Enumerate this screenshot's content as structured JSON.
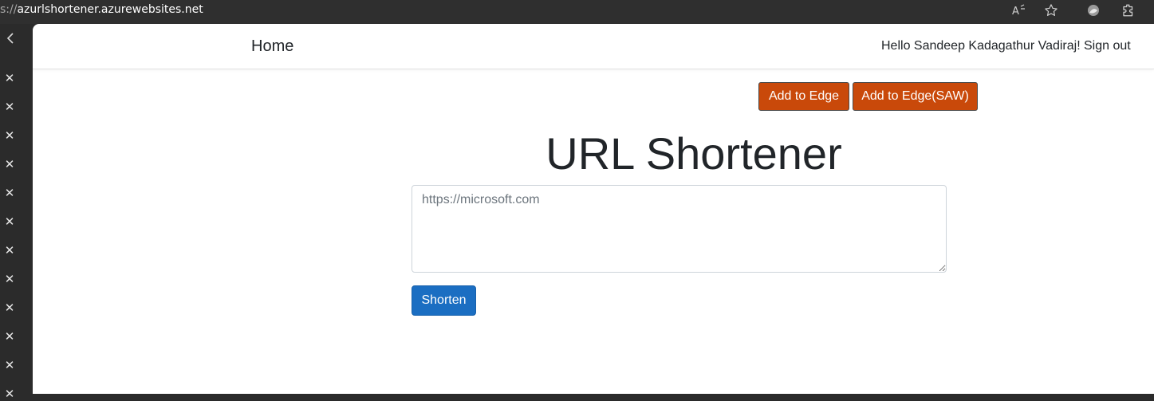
{
  "browser": {
    "url_scheme": "s://",
    "url_host": "azurlshortener.azurewebsites.net",
    "icons": [
      "read-aloud-icon",
      "favorite-star-icon",
      "profile-icon",
      "extensions-icon"
    ]
  },
  "tab_strip": {
    "collapse_icon": "chevron-left-icon",
    "close_icon_glyph": "✕",
    "tab_count": 12
  },
  "navbar": {
    "home_label": "Home",
    "greeting": "Hello Sandeep Kadagathur Vadiraj!",
    "signout_label": "Sign out"
  },
  "actions": {
    "add_to_edge_label": "Add to Edge",
    "add_to_edge_saw_label": "Add to Edge(SAW)"
  },
  "main": {
    "title": "URL Shortener",
    "url_input_placeholder": "https://microsoft.com",
    "url_input_value": "",
    "shorten_label": "Shorten"
  },
  "colors": {
    "accent_orange": "#c9490a",
    "primary_blue": "#1b6ec2"
  }
}
